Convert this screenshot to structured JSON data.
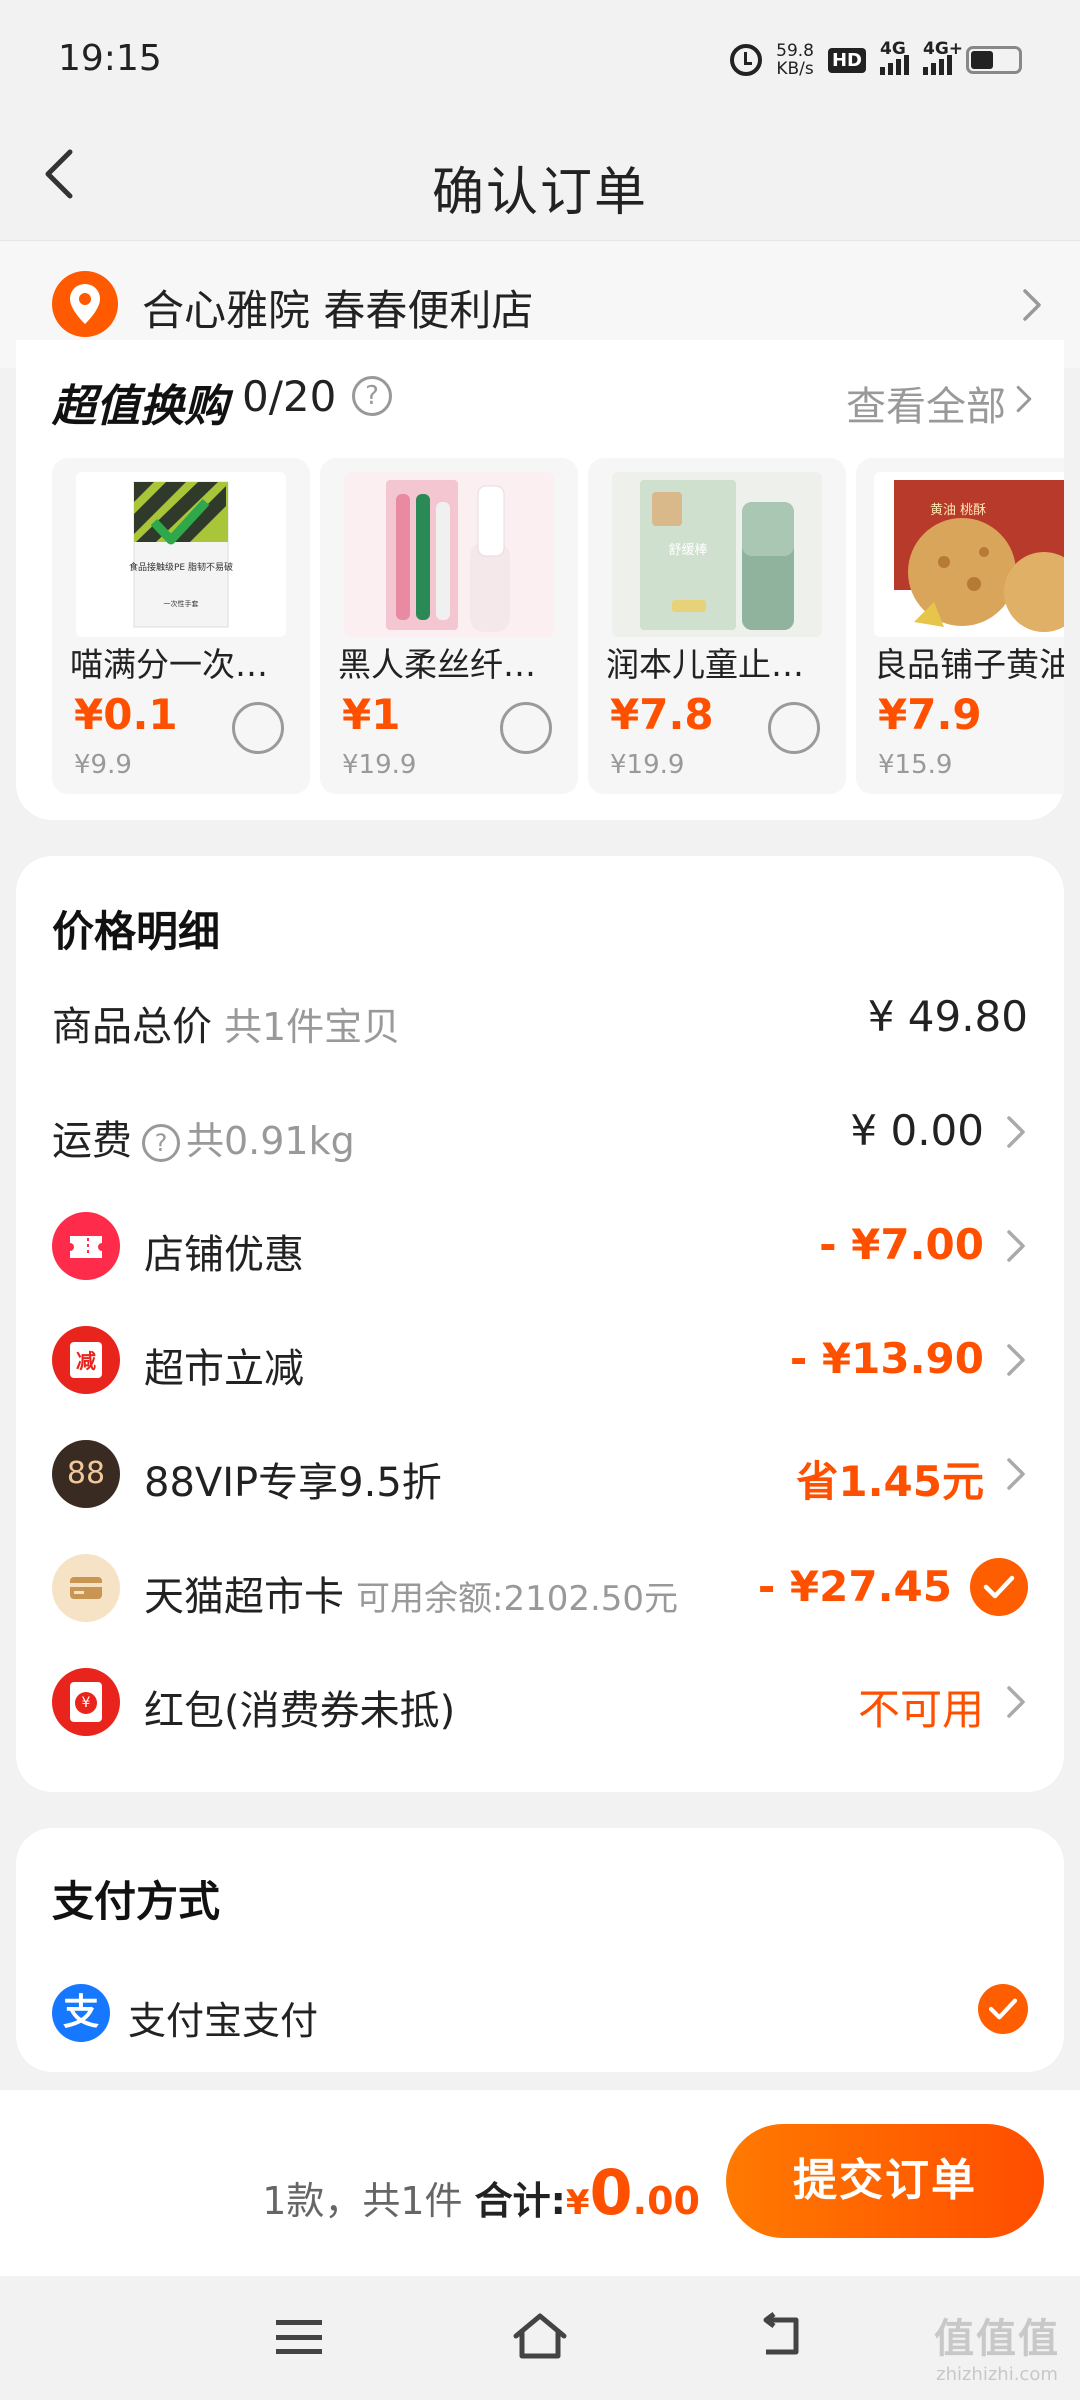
{
  "status": {
    "time": "19:15",
    "net_speed": "59.8",
    "net_unit": "KB/s",
    "hd": "HD",
    "sim1": "4G",
    "sim2": "4G+"
  },
  "nav": {
    "title": "确认订单"
  },
  "address": {
    "text": "合心雅院  春春便利店"
  },
  "exchange": {
    "title": "超值换购",
    "count": "0/20",
    "help": "?",
    "view_all": "查看全部",
    "products": [
      {
        "name": "喵满分一次性PE手套",
        "price": "¥0.1",
        "original": "¥9.9",
        "pack_text": "食品接触级PE 脂韧不易破",
        "pack_sub": "一次性手套"
      },
      {
        "name": "黑人柔丝纤毛牙刷",
        "price": "¥1",
        "original": "¥19.9"
      },
      {
        "name": "润本儿童止痒舒缓棒",
        "price": "¥7.8",
        "original": "¥19.9",
        "pack_text": "舒缓棒"
      },
      {
        "name": "良品铺子黄油桃酥",
        "price": "¥7.9",
        "original": "¥15.9",
        "pack_text": "黄油 桃酥"
      }
    ]
  },
  "price_detail": {
    "title": "价格明细",
    "goods_total": {
      "label": "商品总价",
      "sub": "共1件宝贝",
      "value": "¥ 49.80"
    },
    "shipping": {
      "label": "运费",
      "help": "?",
      "sub": "共0.91kg",
      "value": "¥ 0.00"
    },
    "store_discount": {
      "label": "店铺优惠",
      "value": "- ¥7.00"
    },
    "market_cut": {
      "label": "超市立减",
      "badge_text": "减",
      "value": "- ¥13.90"
    },
    "vip": {
      "label": "88VIP专享9.5折",
      "badge_text": "88",
      "value": "省1.45元"
    },
    "market_card": {
      "label": "天猫超市卡",
      "sub": "可用余额:2102.50元",
      "value": "- ¥27.45"
    },
    "red_packet": {
      "label": "红包(消费券未抵)",
      "badge_text": "¥",
      "value": "不可用"
    }
  },
  "payment": {
    "title": "支付方式",
    "alipay_icon": "支",
    "method": "支付宝支付"
  },
  "submit_bar": {
    "count_text": "1款，共1件",
    "total_label": "合计:",
    "currency": "¥",
    "total_int": "0",
    "total_dec": ".00",
    "button": "提交订单"
  },
  "watermark": {
    "brand": "值值值",
    "site": "zhizhizhi.com"
  },
  "colors": {
    "accent": "#ff5000",
    "alipay": "#1677ff",
    "vip_badge": "#3a2b22"
  }
}
